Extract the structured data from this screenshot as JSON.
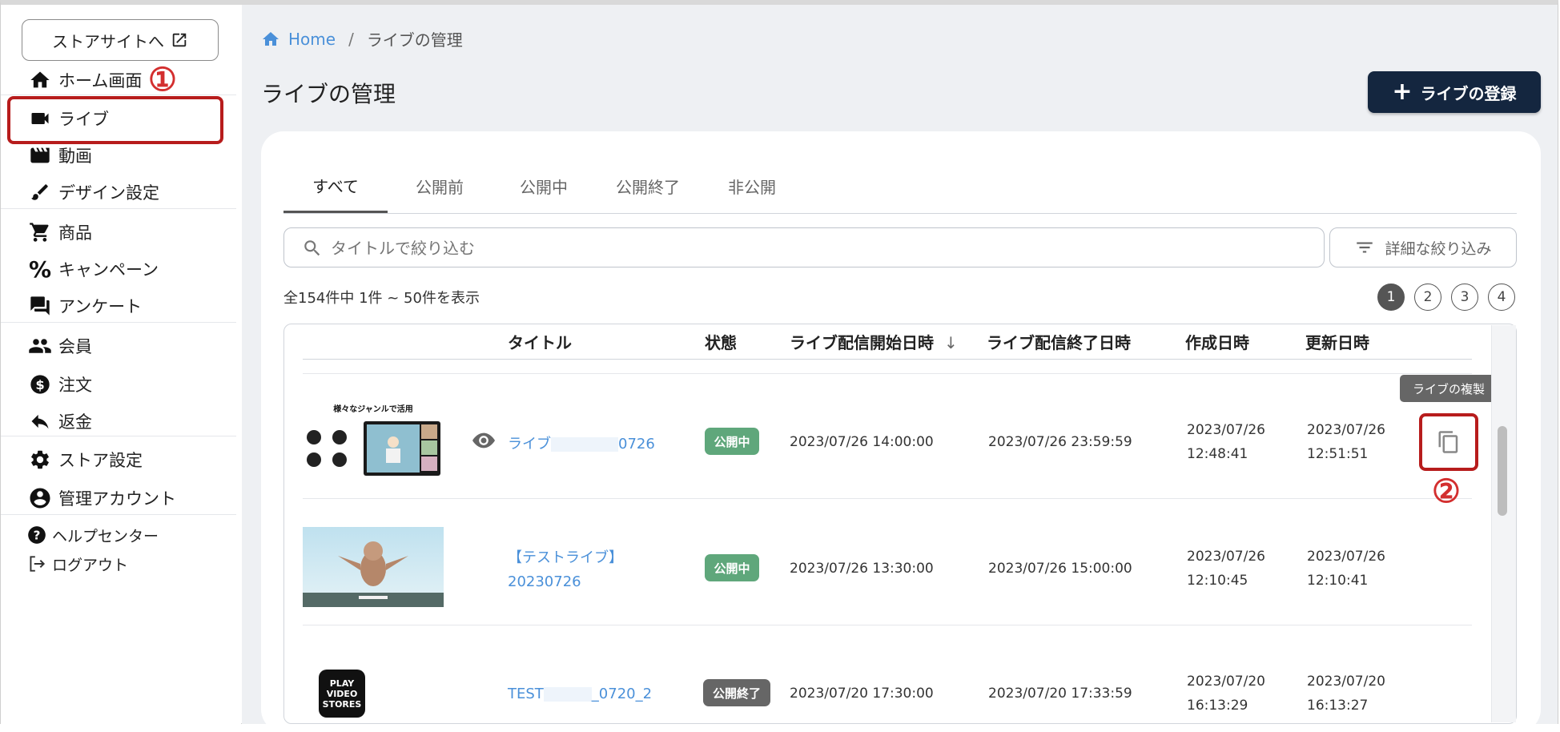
{
  "sidebar": {
    "store_button": "ストアサイトへ",
    "items": [
      {
        "label": "ホーム画面",
        "icon": "home-icon"
      },
      {
        "label": "ライブ",
        "icon": "videocam-icon"
      },
      {
        "label": "動画",
        "icon": "movie-icon"
      },
      {
        "label": "デザイン設定",
        "icon": "brush-icon"
      },
      {
        "label": "商品",
        "icon": "cart-icon"
      },
      {
        "label": "キャンペーン",
        "icon": "percent-icon"
      },
      {
        "label": "アンケート",
        "icon": "forum-icon"
      },
      {
        "label": "会員",
        "icon": "people-icon"
      },
      {
        "label": "注文",
        "icon": "dollar-icon"
      },
      {
        "label": "返金",
        "icon": "reply-icon"
      },
      {
        "label": "ストア設定",
        "icon": "gear-icon"
      },
      {
        "label": "管理アカウント",
        "icon": "account-icon"
      },
      {
        "label": "ヘルプセンター",
        "icon": "help-icon"
      },
      {
        "label": "ログアウト",
        "icon": "logout-icon"
      }
    ],
    "annotation_1": "①"
  },
  "breadcrumb": {
    "home": "Home",
    "separator": "/",
    "current": "ライブの管理"
  },
  "page_title": "ライブの管理",
  "register_button": "ライブの登録",
  "tabs": [
    "すべて",
    "公開前",
    "公開中",
    "公開終了",
    "非公開"
  ],
  "search": {
    "placeholder": "タイトルで絞り込む"
  },
  "filter_button": "詳細な絞り込み",
  "count_text": "全154件中 1件 ~ 50件を表示",
  "pages": [
    "1",
    "2",
    "3",
    "4"
  ],
  "table": {
    "headers": [
      "タイトル",
      "状態",
      "ライブ配信開始日時",
      "ライブ配信終了日時",
      "作成日時",
      "更新日時"
    ],
    "sort_arrow": "↓",
    "rows": [
      {
        "thumb_caption": "様々なジャンルで活用",
        "title_start": "ライブ",
        "title_end": "0726",
        "status": "公開中",
        "start": "2023/07/26 14:00:00",
        "end": "2023/07/26 23:59:59",
        "created_date": "2023/07/26",
        "created_time": "12:48:41",
        "updated_date": "2023/07/26",
        "updated_time": "12:51:51"
      },
      {
        "title_line1": "【テストライブ】",
        "title_line2": "20230726",
        "status": "公開中",
        "start": "2023/07/26 13:30:00",
        "end": "2023/07/26 15:00:00",
        "created_date": "2023/07/26",
        "created_time": "12:10:45",
        "updated_date": "2023/07/26",
        "updated_time": "12:10:41"
      },
      {
        "thumb_text": [
          "PLAY",
          "VIDEO",
          "STORES"
        ],
        "title_start": "TEST",
        "title_end": "_0720_2",
        "status": "公開終了",
        "start": "2023/07/20 17:30:00",
        "end": "2023/07/20 17:33:59",
        "created_date": "2023/07/20",
        "created_time": "16:13:29",
        "updated_date": "2023/07/20",
        "updated_time": "16:13:27"
      }
    ]
  },
  "tooltip": "ライブの複製",
  "annotation_2": "②",
  "colors": {
    "primary": "#14263f",
    "link": "#4a90d9",
    "status_public": "#5fa77b",
    "status_ended": "#666666",
    "annotation": "#b71c1c"
  }
}
